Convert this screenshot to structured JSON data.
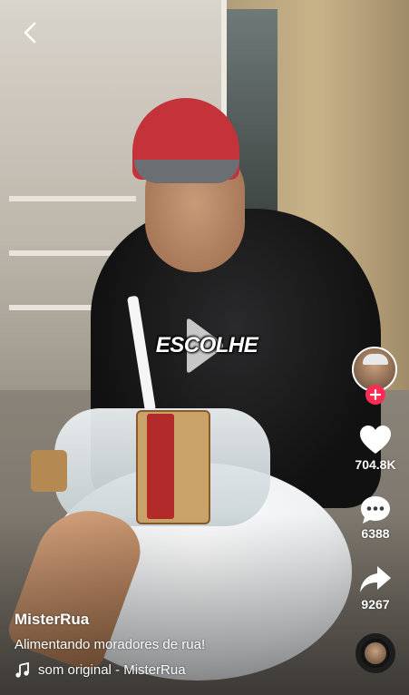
{
  "header": {
    "back_icon": "chevron-left-icon"
  },
  "video": {
    "caption_word": "ESCOLHE",
    "play_icon": "play-icon"
  },
  "actions": {
    "avatar_icon": "creator-avatar",
    "follow_icon": "plus-icon",
    "likes": "704.8K",
    "comments": "6388",
    "shares": "9267"
  },
  "post": {
    "username": "MisterRua",
    "description": "Alimentando moradores de rua!",
    "sound": "som original - MisterRua"
  },
  "colors": {
    "follow": "#fe2c55",
    "text": "#ffffff"
  }
}
